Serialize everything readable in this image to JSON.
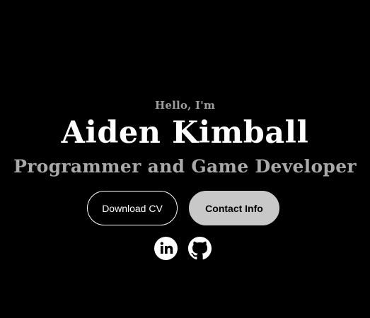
{
  "hero": {
    "greeting": "Hello, I'm",
    "name": "Aiden Kimball",
    "role": "Programmer and Game Developer"
  },
  "buttons": {
    "download_label": "Download CV",
    "contact_label": "Contact Info"
  },
  "social": {
    "icons": [
      "linkedin-icon",
      "github-icon"
    ]
  },
  "colors": {
    "background": "#000000",
    "name_text": "#ffffff",
    "subtitle_text": "#a9a9a9",
    "contact_button_bg": "#c8c8c8"
  }
}
